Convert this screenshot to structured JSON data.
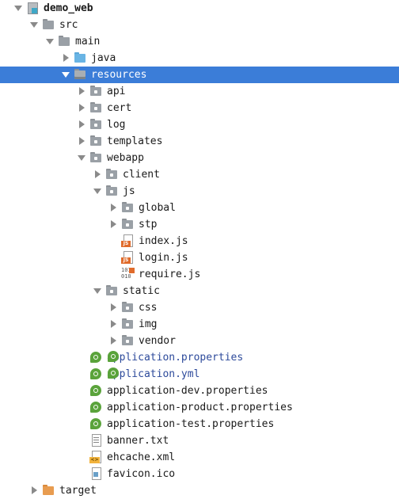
{
  "project_tree": {
    "selected_index": 4,
    "nodes": [
      {
        "label": "demo_web",
        "depth": 0,
        "expander": "expanded",
        "icon": "module-icon",
        "style": "bold"
      },
      {
        "label": "src",
        "depth": 1,
        "expander": "expanded",
        "icon": "folder-icon"
      },
      {
        "label": "main",
        "depth": 2,
        "expander": "expanded",
        "icon": "folder-icon"
      },
      {
        "label": "java",
        "depth": 3,
        "expander": "collapsed",
        "icon": "source-folder-icon"
      },
      {
        "label": "resources",
        "depth": 3,
        "expander": "expanded",
        "icon": "resources-folder-icon"
      },
      {
        "label": "api",
        "depth": 4,
        "expander": "collapsed",
        "icon": "package-folder-icon"
      },
      {
        "label": "cert",
        "depth": 4,
        "expander": "collapsed",
        "icon": "package-folder-icon"
      },
      {
        "label": "log",
        "depth": 4,
        "expander": "collapsed",
        "icon": "package-folder-icon"
      },
      {
        "label": "templates",
        "depth": 4,
        "expander": "collapsed",
        "icon": "package-folder-icon"
      },
      {
        "label": "webapp",
        "depth": 4,
        "expander": "expanded",
        "icon": "package-folder-icon"
      },
      {
        "label": "client",
        "depth": 5,
        "expander": "collapsed",
        "icon": "package-folder-icon"
      },
      {
        "label": "js",
        "depth": 5,
        "expander": "expanded",
        "icon": "package-folder-icon"
      },
      {
        "label": "global",
        "depth": 6,
        "expander": "collapsed",
        "icon": "package-folder-icon"
      },
      {
        "label": "stp",
        "depth": 6,
        "expander": "collapsed",
        "icon": "package-folder-icon"
      },
      {
        "label": "index.js",
        "depth": 6,
        "expander": "none",
        "icon": "javascript-file-icon"
      },
      {
        "label": "login.js",
        "depth": 6,
        "expander": "none",
        "icon": "javascript-file-icon"
      },
      {
        "label": "require.js",
        "depth": 6,
        "expander": "none",
        "icon": "binary-javascript-file-icon"
      },
      {
        "label": "static",
        "depth": 5,
        "expander": "expanded",
        "icon": "package-folder-icon"
      },
      {
        "label": "css",
        "depth": 6,
        "expander": "collapsed",
        "icon": "package-folder-icon"
      },
      {
        "label": "img",
        "depth": 6,
        "expander": "collapsed",
        "icon": "package-folder-icon"
      },
      {
        "label": "vendor",
        "depth": 6,
        "expander": "collapsed",
        "icon": "package-folder-icon"
      },
      {
        "label": "application.properties",
        "depth": 4,
        "expander": "none",
        "icon": "spring-config-icon",
        "style": "spring"
      },
      {
        "label": "application.yml",
        "depth": 4,
        "expander": "none",
        "icon": "spring-config-icon",
        "style": "spring"
      },
      {
        "label": "application-dev.properties",
        "depth": 4,
        "expander": "none",
        "icon": "spring-config-icon"
      },
      {
        "label": "application-product.properties",
        "depth": 4,
        "expander": "none",
        "icon": "spring-config-icon"
      },
      {
        "label": "application-test.properties",
        "depth": 4,
        "expander": "none",
        "icon": "spring-config-icon"
      },
      {
        "label": "banner.txt",
        "depth": 4,
        "expander": "none",
        "icon": "text-file-icon"
      },
      {
        "label": "ehcache.xml",
        "depth": 4,
        "expander": "none",
        "icon": "xml-file-icon"
      },
      {
        "label": "favicon.ico",
        "depth": 4,
        "expander": "none",
        "icon": "image-file-icon"
      },
      {
        "label": "target",
        "depth": 1,
        "expander": "collapsed",
        "icon": "excluded-folder-icon"
      }
    ]
  },
  "colors": {
    "selection": "#3b7dd8",
    "spring_label": "#2d4a9b",
    "text": "#1a1a1a"
  }
}
